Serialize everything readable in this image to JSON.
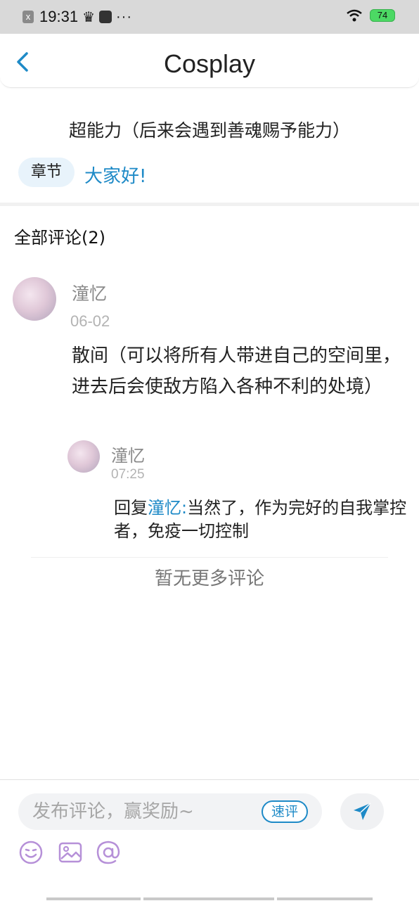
{
  "status_bar": {
    "time": "19:31",
    "battery": "74",
    "battery_color": "#4cd964"
  },
  "header": {
    "title": "Cosplay",
    "back_icon": "chevron-left-icon",
    "accent": "#1e8ac7"
  },
  "story": {
    "title": "超能力（后来会遇到善魂赐予能力）",
    "chapter_tag": "章节",
    "chapter_name": "大家好!"
  },
  "comments": {
    "header": "全部评论(2)",
    "items": [
      {
        "user": "潼忆",
        "date": "06-02",
        "text": "散间（可以将所有人带进自己的空间里，进去后会使敌方陷入各种不利的处境）",
        "reply": {
          "user": "潼忆",
          "time": "07:25",
          "prefix": "回复",
          "mention": "潼忆:",
          "text": "当然了，作为完好的自我掌控者，免疫一切控制"
        }
      }
    ],
    "no_more": "暂无更多评论"
  },
  "composer": {
    "placeholder": "发布评论，赢奖励~",
    "quick_review": "速评",
    "send_icon": "send-icon",
    "tools": [
      "emoji-icon",
      "image-icon",
      "at-icon"
    ]
  }
}
